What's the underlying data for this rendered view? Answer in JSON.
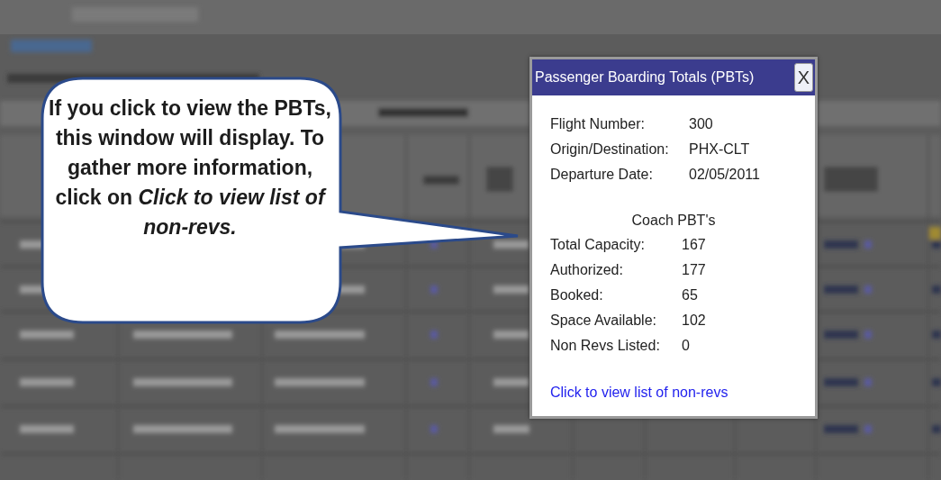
{
  "callout": {
    "text": "If you click to view the PBTs, this window will display. To gather more information, click on *Click to view list of non-revs.*"
  },
  "popup": {
    "title": "Passenger Boarding Totals (PBTs)",
    "close": "X",
    "flight_info": [
      {
        "label": "Flight Number:",
        "value": "300"
      },
      {
        "label": "Origin/Destination:",
        "value": "PHX-CLT"
      },
      {
        "label": "Departure Date:",
        "value": "02/05/2011"
      }
    ],
    "section_title": "Coach PBT's",
    "totals": [
      {
        "label": "Total Capacity:",
        "value": "167"
      },
      {
        "label": "Authorized:",
        "value": "177"
      },
      {
        "label": "Booked:",
        "value": "65"
      },
      {
        "label": "Space Available:",
        "value": "102"
      },
      {
        "label": "Non Revs Listed:",
        "value": "0"
      }
    ],
    "link": "Click to view list of non-revs"
  }
}
